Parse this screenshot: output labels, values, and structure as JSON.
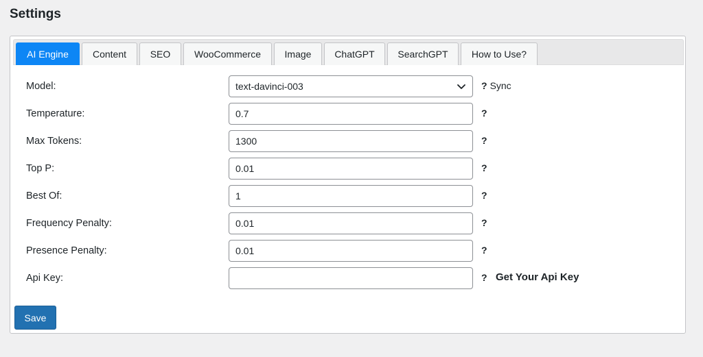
{
  "page": {
    "title": "Settings"
  },
  "tabs": [
    {
      "label": "AI Engine",
      "active": true
    },
    {
      "label": "Content"
    },
    {
      "label": "SEO"
    },
    {
      "label": "WooCommerce"
    },
    {
      "label": "Image"
    },
    {
      "label": "ChatGPT"
    },
    {
      "label": "SearchGPT"
    },
    {
      "label": "How to Use?"
    }
  ],
  "form": {
    "model": {
      "label": "Model:",
      "value": "text-davinci-003",
      "help": "?",
      "help_extra": "Sync"
    },
    "temperature": {
      "label": "Temperature:",
      "value": "0.7",
      "help": "?"
    },
    "max_tokens": {
      "label": "Max Tokens:",
      "value": "1300",
      "help": "?"
    },
    "top_p": {
      "label": "Top P:",
      "value": "0.01",
      "help": "?"
    },
    "best_of": {
      "label": "Best Of:",
      "value": "1",
      "help": "?"
    },
    "frequency_penalty": {
      "label": "Frequency Penalty:",
      "value": "0.01",
      "help": "?"
    },
    "presence_penalty": {
      "label": "Presence Penalty:",
      "value": "0.01",
      "help": "?"
    },
    "api_key": {
      "label": "Api Key:",
      "value": "",
      "help": "?",
      "link": "Get Your Api Key"
    }
  },
  "actions": {
    "save_label": "Save"
  },
  "colors": {
    "active_tab": "#0d86f5",
    "save_button": "#2271b1"
  },
  "icons": {
    "select_arrow": "chevron-down-icon"
  }
}
